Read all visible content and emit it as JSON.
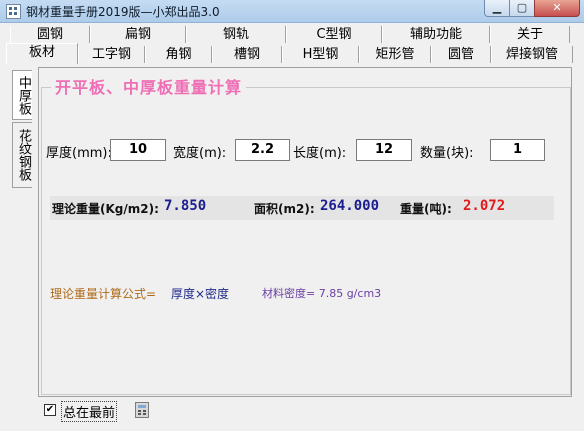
{
  "window": {
    "title": "钢材重量手册2019版—小郑出品3.0",
    "min_glyph": "▁",
    "max_glyph": "▢",
    "close_glyph": "✕"
  },
  "tabs_row1": [
    "圆钢",
    "扁钢",
    "钢轨",
    "C型钢",
    "辅助功能",
    "关于"
  ],
  "tabs_row2": [
    "板材",
    "工字钢",
    "角钢",
    "槽钢",
    "H型钢",
    "矩形管",
    "圆管",
    "焊接钢管"
  ],
  "selected_tab": "板材",
  "side_tabs": [
    "中厚板",
    "花纹钢板"
  ],
  "section_title": "开平板、中厚板重量计算",
  "inputs": {
    "thickness_label": "厚度(mm):",
    "thickness_value": "10",
    "width_label": "宽度(m):",
    "width_value": "2.2",
    "length_label": "长度(m):",
    "length_value": "12",
    "quantity_label": "数量(块):",
    "quantity_value": "1"
  },
  "results": {
    "theoretical_weight_label": "理论重量(Kg/m2):",
    "theoretical_weight_value": "7.850",
    "area_label": "面积(m2):",
    "area_value": "264.000",
    "weight_label": "重量(吨):",
    "weight_value": "2.072"
  },
  "formula": {
    "label": "理论重量计算公式=",
    "expression": "厚度×密度",
    "density": "材料密度= 7.85 g/cm3"
  },
  "bottom": {
    "always_on_top_label": "总在最前",
    "always_on_top_checked": "✔"
  },
  "colors": {
    "title_pink": "#ee6fb5",
    "value_blue": "#1b1e8e",
    "value_red": "#e11b1b",
    "formula_brown": "#b06a1a",
    "formula_navy": "#1f2a8a",
    "density_purple": "#6b3fa0"
  }
}
